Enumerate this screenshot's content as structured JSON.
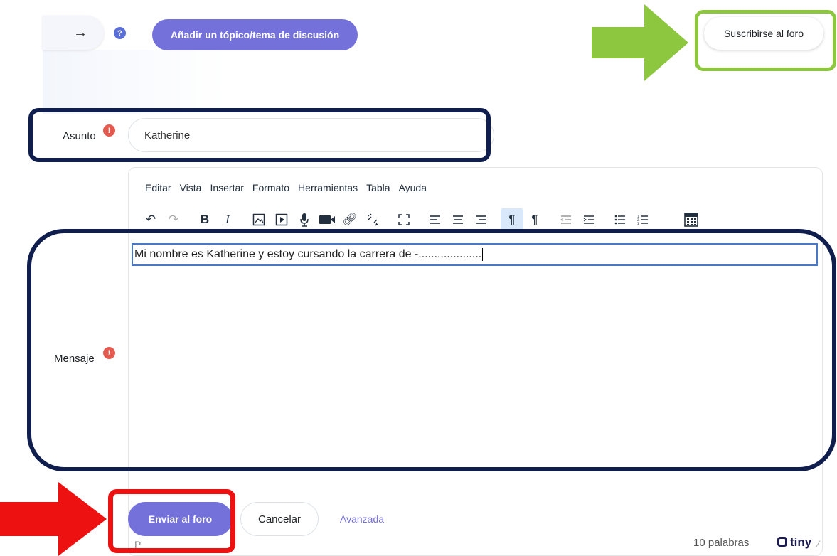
{
  "top": {
    "arrow_glyph": "→",
    "help_glyph": "?",
    "add_topic_label": "Añadir un tópico/tema de discusión",
    "subscribe_label": "Suscribirse al foro"
  },
  "form": {
    "subject_label": "Asunto",
    "subject_value": "Katherine",
    "message_label": "Mensaje",
    "required_glyph": "!"
  },
  "editor": {
    "menu": [
      "Editar",
      "Vista",
      "Insertar",
      "Formato",
      "Herramientas",
      "Tabla",
      "Ayuda"
    ],
    "content": "Mi nombre es Katherine y estoy cursando la carrera de -....................",
    "status_element": "P",
    "word_count": "10 palabras",
    "brand": "tiny"
  },
  "actions": {
    "send_label": "Enviar al foro",
    "cancel_label": "Cancelar",
    "advanced_label": "Avanzada"
  },
  "annotations": {
    "green": "#8dc63f",
    "navy": "#0f1e4d",
    "red": "#ee1111"
  },
  "colors": {
    "accent": "#7471db",
    "required": "#e55a4e",
    "help": "#5b6fd8"
  }
}
